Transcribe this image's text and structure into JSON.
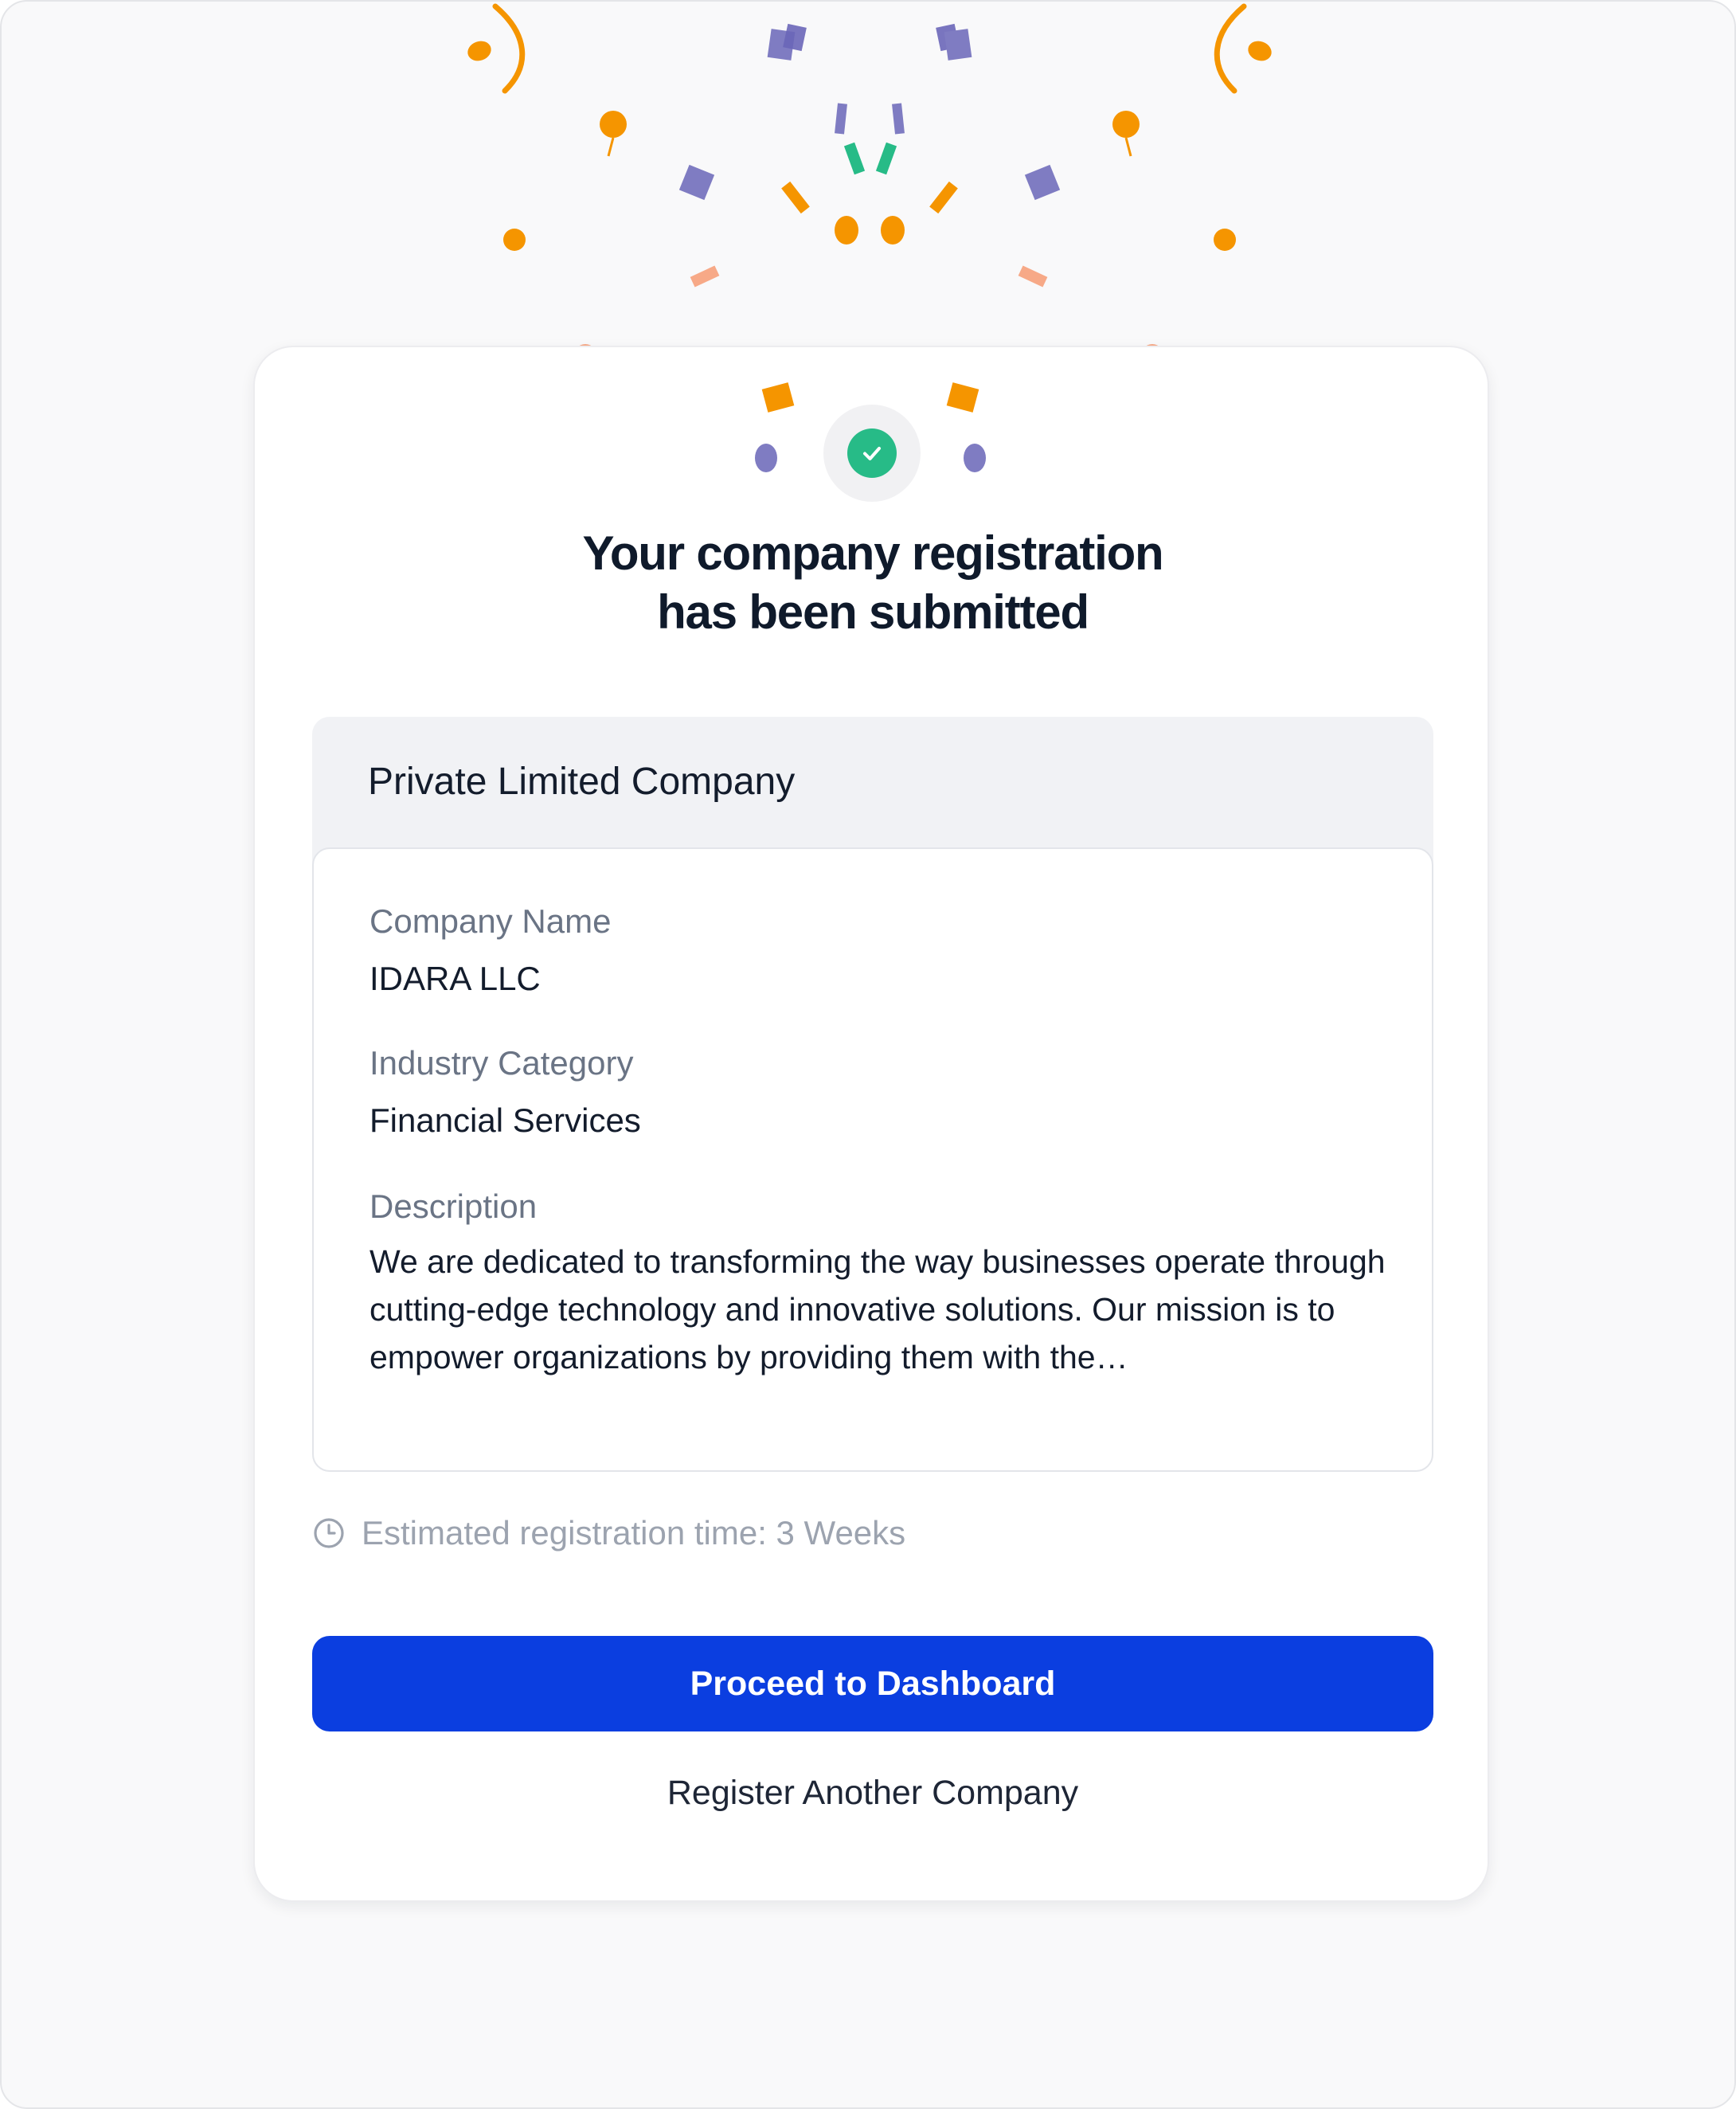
{
  "confirmation": {
    "title_line1": "Your company registration",
    "title_line2": "has been submitted",
    "status_icon": "check-icon"
  },
  "details": {
    "company_type": "Private Limited Company",
    "fields": [
      {
        "label": "Company Name",
        "value": "IDARA LLC"
      },
      {
        "label": "Industry Category",
        "value": "Financial Services"
      },
      {
        "label": "Description",
        "value": "We are dedicated to transforming the way businesses operate through cutting-edge technology and innovative solutions. Our mission is to empower organizations by providing them with the…"
      }
    ]
  },
  "estimate": {
    "icon": "clock-icon",
    "text": "Estimated registration time: 3 Weeks"
  },
  "actions": {
    "primary_label": "Proceed to Dashboard",
    "secondary_label": "Register Another Company"
  },
  "colors": {
    "accent": "#0b3ee0",
    "success": "#27bb87",
    "confetti_orange": "#f59500",
    "confetti_purple": "#7f7cc2",
    "confetti_green": "#27bb87",
    "confetti_peach": "#f7a987"
  }
}
